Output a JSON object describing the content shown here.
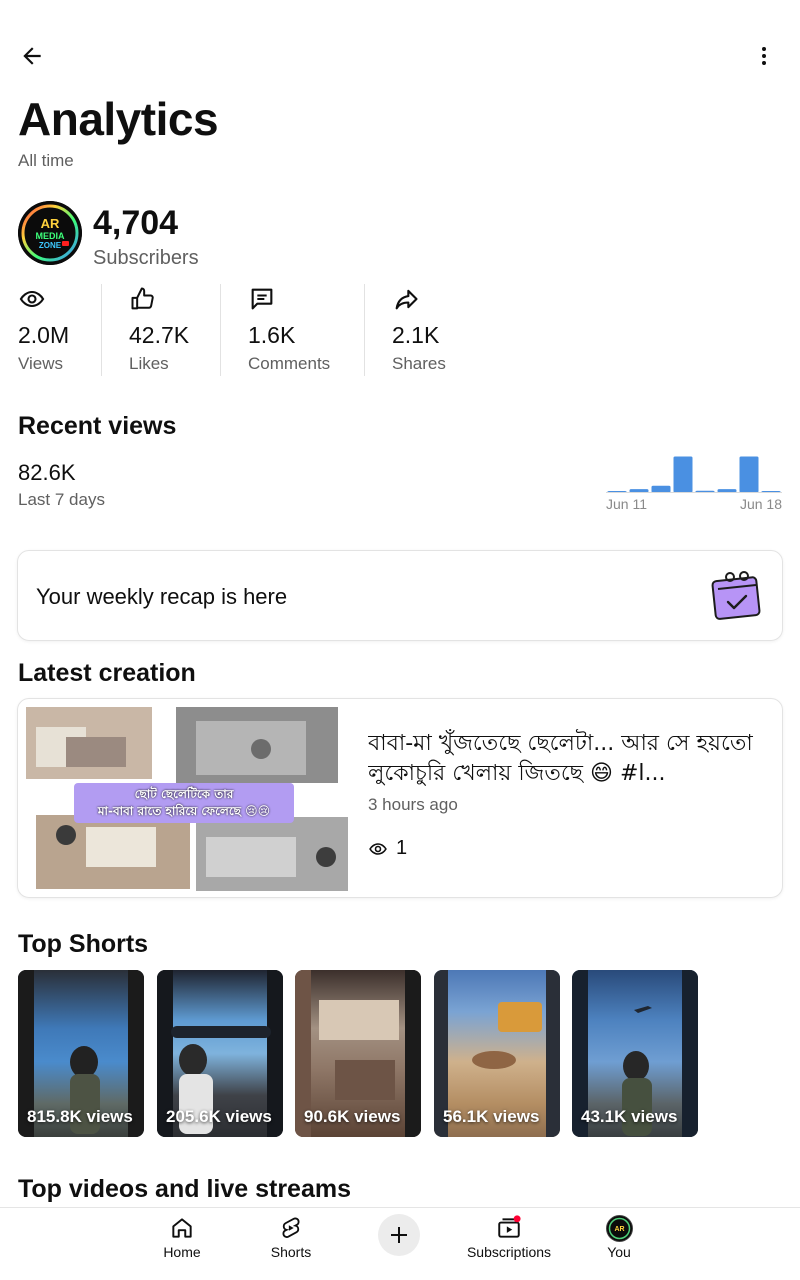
{
  "header": {
    "title": "Analytics",
    "subtitle": "All time"
  },
  "channel": {
    "avatar_text": "AR MEDIA ZONE",
    "subscribers": "4,704",
    "subscribers_label": "Subscribers"
  },
  "stats": [
    {
      "icon": "eye-icon",
      "value": "2.0M",
      "label": "Views"
    },
    {
      "icon": "thumbs-up-icon",
      "value": "42.7K",
      "label": "Likes"
    },
    {
      "icon": "comment-icon",
      "value": "1.6K",
      "label": "Comments"
    },
    {
      "icon": "share-icon",
      "value": "2.1K",
      "label": "Shares"
    }
  ],
  "recent": {
    "title": "Recent views",
    "value": "82.6K",
    "period": "Last 7 days",
    "chart_data": {
      "type": "bar",
      "days": 8,
      "values": [
        0.5,
        1.5,
        3,
        16,
        0.8,
        1.5,
        16,
        0.5
      ],
      "x_start_label": "Jun 11",
      "x_end_label": "Jun 18",
      "color": "#4a90e2"
    }
  },
  "recap": {
    "text": "Your weekly recap is here",
    "icon": "recap-calendar-icon",
    "accent": "#b794f6"
  },
  "latest": {
    "section_title": "Latest creation",
    "thumb_caption_line1": "ছোট ছেলেটিকে তার",
    "thumb_caption_line2": "মা-বাবা রাতে হারিয়ে ফেলেছে 😢😢",
    "title": "বাবা-মা খুঁজতেছে ছেলেটা... আর সে হয়তো লুকোচুরি খেলায় জিতছে 😄 #l...",
    "time": "3 hours ago",
    "views": "1"
  },
  "top_shorts": {
    "section_title": "Top Shorts",
    "items": [
      {
        "views": "815.8K views"
      },
      {
        "views": "205.6K views"
      },
      {
        "views": "90.6K views"
      },
      {
        "views": "56.1K views"
      },
      {
        "views": "43.1K views"
      }
    ]
  },
  "top_videos": {
    "section_title": "Top videos and live streams"
  },
  "nav": {
    "home": "Home",
    "shorts": "Shorts",
    "subscriptions": "Subscriptions",
    "you": "You"
  }
}
